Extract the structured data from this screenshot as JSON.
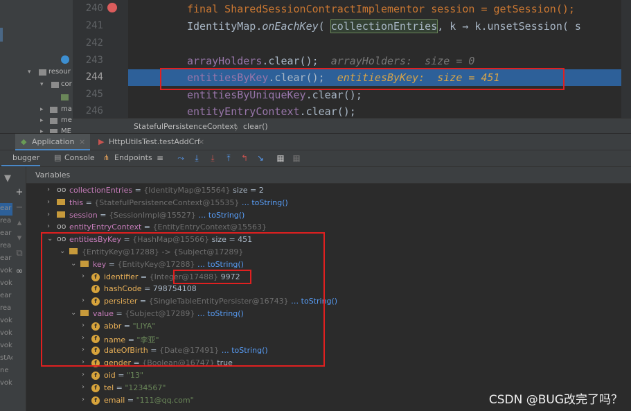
{
  "project_tree": {
    "items": [
      {
        "label": "resour"
      },
      {
        "label": "cor"
      },
      {
        "label": ""
      },
      {
        "label": "ma"
      },
      {
        "label": "me"
      },
      {
        "label": "ME"
      }
    ]
  },
  "editor": {
    "lines": [
      {
        "num": "240",
        "code": "final SharedSessionContractImplementor session = getSession();"
      },
      {
        "num": "241",
        "code_a": "IdentityMap.",
        "code_b": "onEachKey",
        "code_c": "( ",
        "code_d": "collectionEntries",
        "code_e": ", k → k.unsetSession( s"
      },
      {
        "num": "242",
        "code": ""
      },
      {
        "num": "243",
        "code_a": "arrayHolders",
        "code_b": ".clear();",
        "hint": "arrayHolders:  size = 0"
      },
      {
        "num": "244",
        "code_a": "entitiesByKey",
        "code_b": ".clear();",
        "hint": "entitiesByKey:  size = 451"
      },
      {
        "num": "245",
        "code_a": "entitiesByUniqueKey",
        "code_b": ".clear();"
      },
      {
        "num": "246",
        "code_a": "entityEntryContext",
        "code_b": ".clear();"
      }
    ]
  },
  "breadcrumb": {
    "class": "StatefulPersistenceContext",
    "separator": "〉",
    "method": "clear()"
  },
  "debug_tabs": {
    "app": "Application",
    "test": "HttpUtilsTest.testAddCrf"
  },
  "debug_toolbar": {
    "debugger": "bugger",
    "console": "Console",
    "endpoints": "Endpoints"
  },
  "variables": {
    "header": "Variables",
    "left_strip_words": [
      "ear",
      "rea",
      "ear",
      "rea",
      "ear",
      "voke",
      "voke",
      "ear",
      "rea",
      "voke",
      "voke",
      "voke",
      "stAc",
      "ne",
      "voke"
    ],
    "rows": [
      {
        "name": "collectionEntries",
        "eq": " = ",
        "type": "{IdentityMap@15564}",
        "rest": " size = 2",
        "link": ""
      },
      {
        "name": "this",
        "eq": " = ",
        "type": "{StatefulPersistenceContext@15535}",
        "rest": "",
        "link": " … toString()"
      },
      {
        "name": "session",
        "eq": " = ",
        "type": "{SessionImpl@15527}",
        "rest": "",
        "link": " … toString()"
      },
      {
        "name": "entityEntryContext",
        "eq": " = ",
        "type": "{EntityEntryContext@15563}",
        "rest": "",
        "link": ""
      },
      {
        "name": "entitiesByKey",
        "eq": " = ",
        "type": "{HashMap@15566}",
        "rest": " size = 451",
        "link": ""
      },
      {
        "name": "",
        "eq": "",
        "type": "{EntityKey@17288}  -> {Subject@17289}",
        "rest": "",
        "link": ""
      },
      {
        "name": "key",
        "eq": " = ",
        "type": "{EntityKey@17288}",
        "rest": "",
        "link": " … toString()"
      },
      {
        "name": "identifier",
        "eq": " = ",
        "type": "{Integer@17488}",
        "rest": " 9972",
        "link": ""
      },
      {
        "name": "hashCode",
        "eq": " = ",
        "type": "",
        "rest": "798754108",
        "link": ""
      },
      {
        "name": "persister",
        "eq": " = ",
        "type": "{SingleTableEntityPersister@16743}",
        "rest": "",
        "link": " … toString()"
      },
      {
        "name": "value",
        "eq": " = ",
        "type": "{Subject@17289}",
        "rest": "",
        "link": " … toString()"
      },
      {
        "name": "abbr",
        "eq": " = ",
        "type": "",
        "str": "\"LIYA\"",
        "rest": "",
        "link": ""
      },
      {
        "name": "name",
        "eq": " = ",
        "type": "",
        "str": "\"李亚\"",
        "rest": "",
        "link": ""
      },
      {
        "name": "dateOfBirth",
        "eq": " = ",
        "type": "{Date@17491}",
        "rest": "",
        "link": " … toString()"
      },
      {
        "name": "gender",
        "eq": " = ",
        "type": "{Boolean@16747}",
        "rest": " true",
        "link": ""
      },
      {
        "name": "oid",
        "eq": " = ",
        "type": "",
        "str": "\"13\"",
        "rest": "",
        "link": ""
      },
      {
        "name": "tel",
        "eq": " = ",
        "type": "",
        "str": "\"1234567\"",
        "rest": "",
        "link": ""
      },
      {
        "name": "email",
        "eq": " = ",
        "type": "",
        "str": "\"111@qq.com\"",
        "rest": "",
        "link": ""
      }
    ]
  },
  "watermark": "CSDN @BUG改完了吗？",
  "colors": {
    "selection_line": "#2d6099",
    "annotation_red": "#e02020",
    "field_purple": "#9876aa",
    "keyword_orange": "#cc7832"
  }
}
